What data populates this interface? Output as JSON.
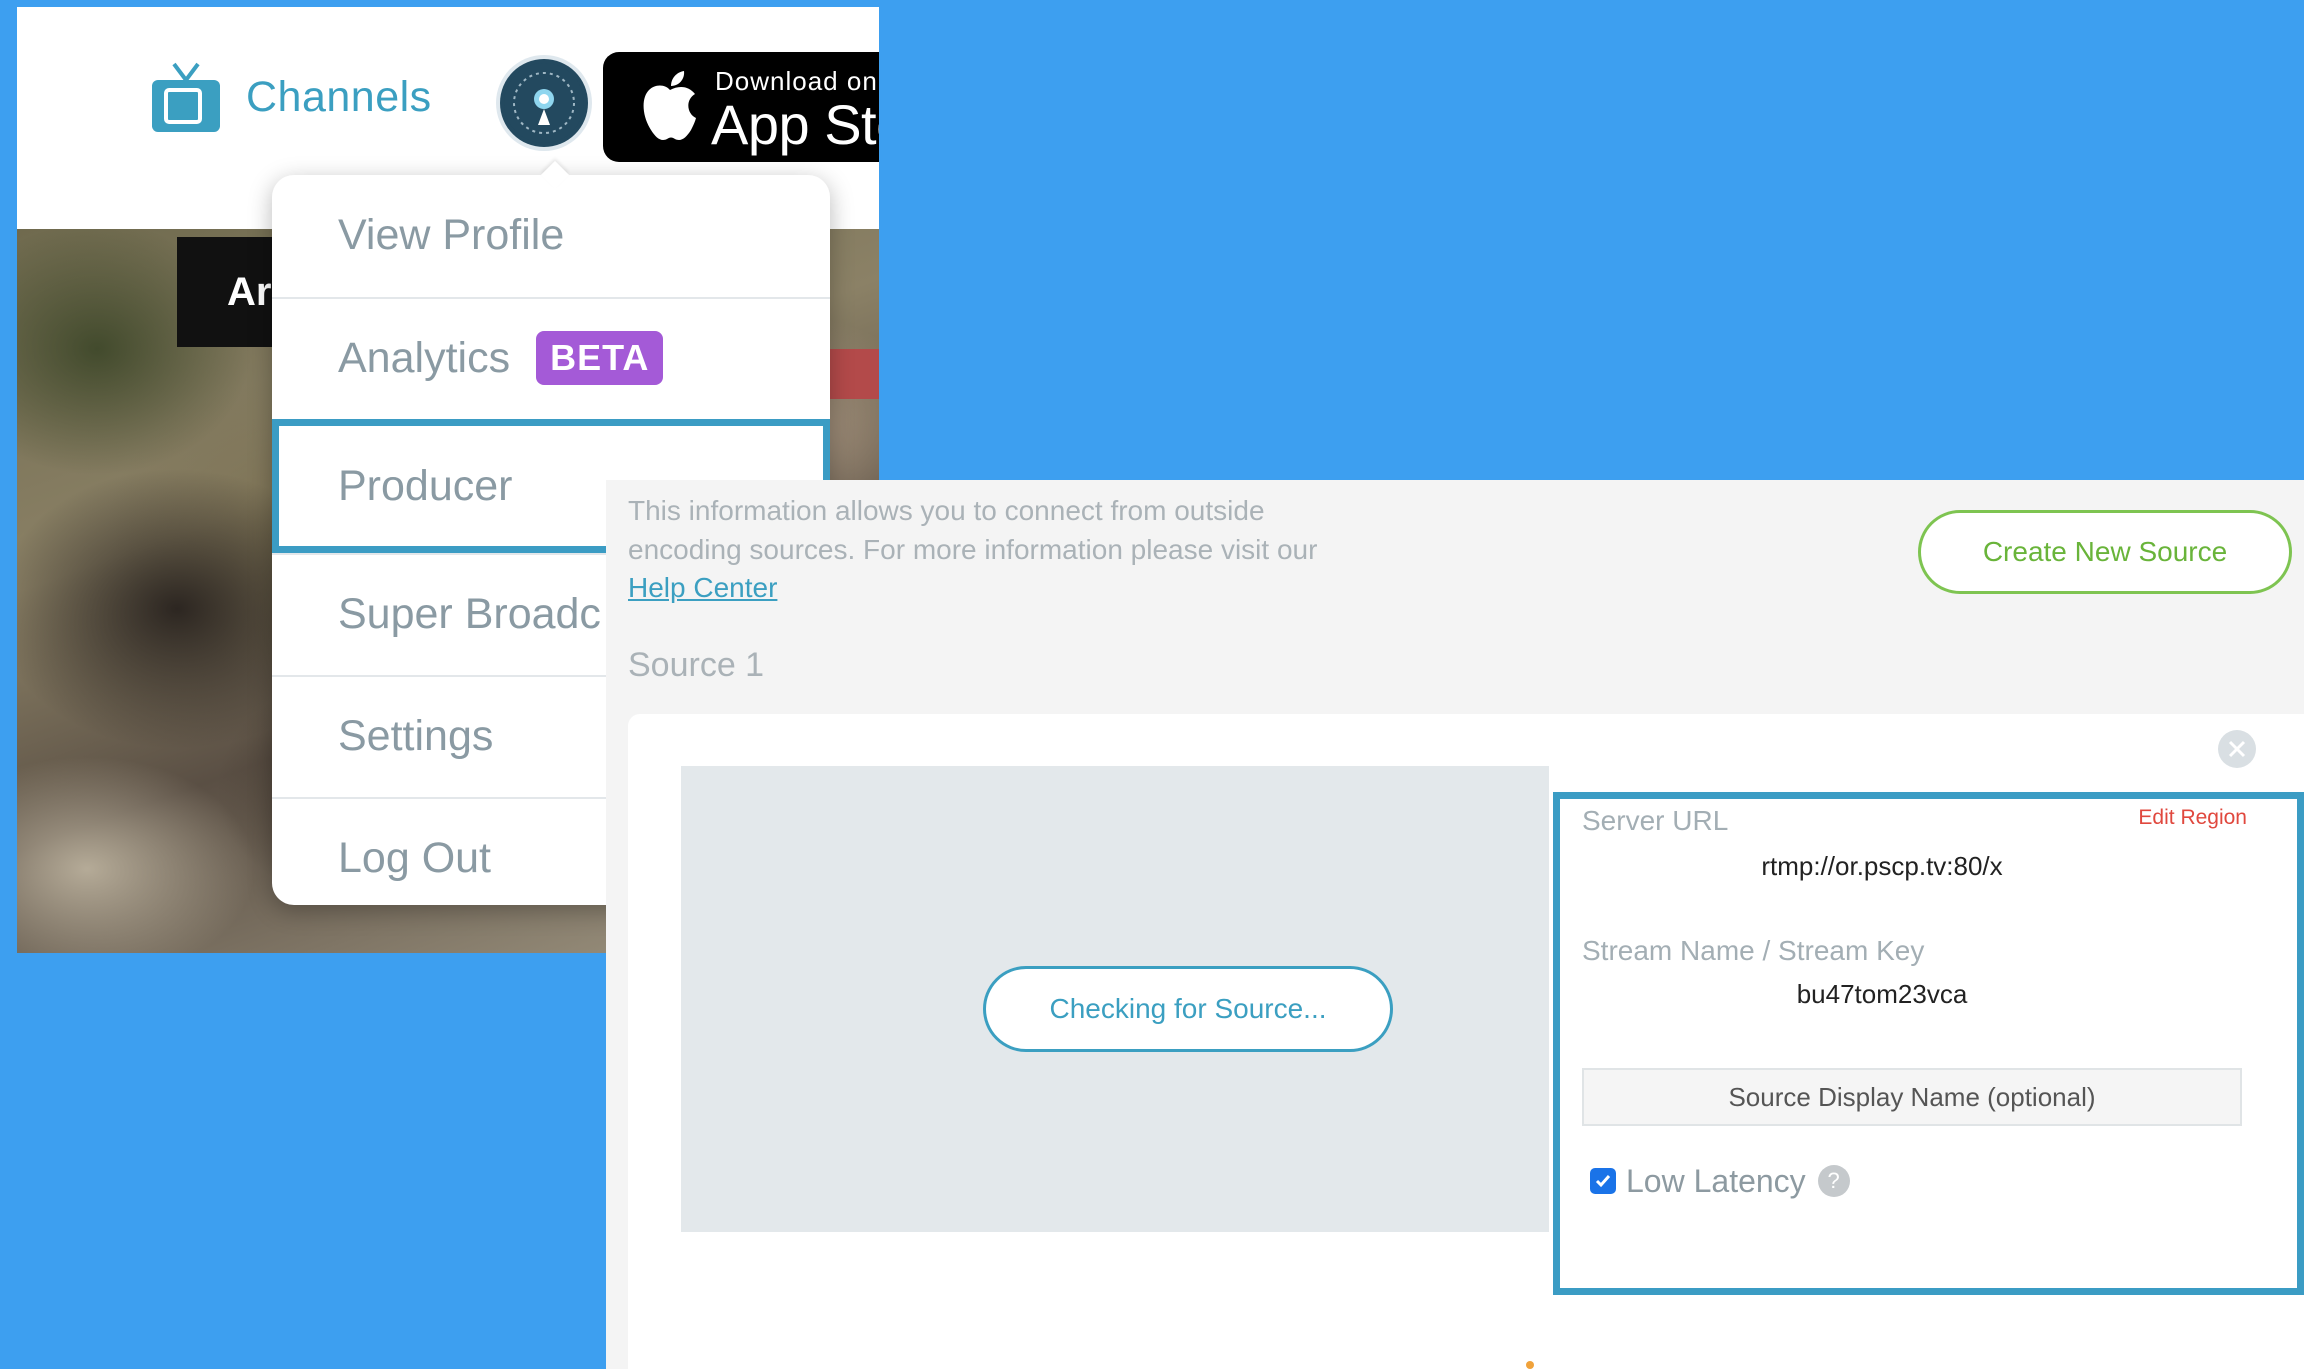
{
  "header": {
    "channels_label": "Channels",
    "app_store": {
      "small_text": "Download on",
      "big_text": "App Sto"
    }
  },
  "video": {
    "caption_text": "Ar"
  },
  "dropdown": {
    "items": [
      {
        "label": "View Profile"
      },
      {
        "label": "Analytics",
        "badge": "BETA"
      },
      {
        "label": "Producer",
        "highlighted": true
      },
      {
        "label": "Super Broadc"
      },
      {
        "label": "Settings"
      },
      {
        "label": "Log Out"
      }
    ]
  },
  "producer": {
    "intro_text": "This information allows you to connect from outside encoding sources. For more information please visit our",
    "help_link": "Help Center",
    "create_button": "Create New Source",
    "source_title": "Source 1",
    "checking_button": "Checking for Source...",
    "server_url_label": "Server URL",
    "edit_region": "Edit Region",
    "server_url_value": "rtmp://or.pscp.tv:80/x",
    "stream_key_label": "Stream Name / Stream Key",
    "stream_key_value": "bu47tom23vca",
    "display_name_placeholder": "Source Display Name (optional)",
    "low_latency_label": "Low Latency",
    "low_latency_checked": true,
    "help_icon_text": "?"
  },
  "colors": {
    "background": "#3d9ff0",
    "accent_blue": "#3b9fc1",
    "highlight_border": "#3b9cc4",
    "beta_purple": "#a45ad7",
    "create_green": "#69b43a",
    "edit_region_red": "#e0483e"
  },
  "icons": [
    "tv-icon",
    "avatar-badge-icon",
    "apple-icon",
    "close-icon",
    "checkbox-checked-icon",
    "help-icon"
  ]
}
